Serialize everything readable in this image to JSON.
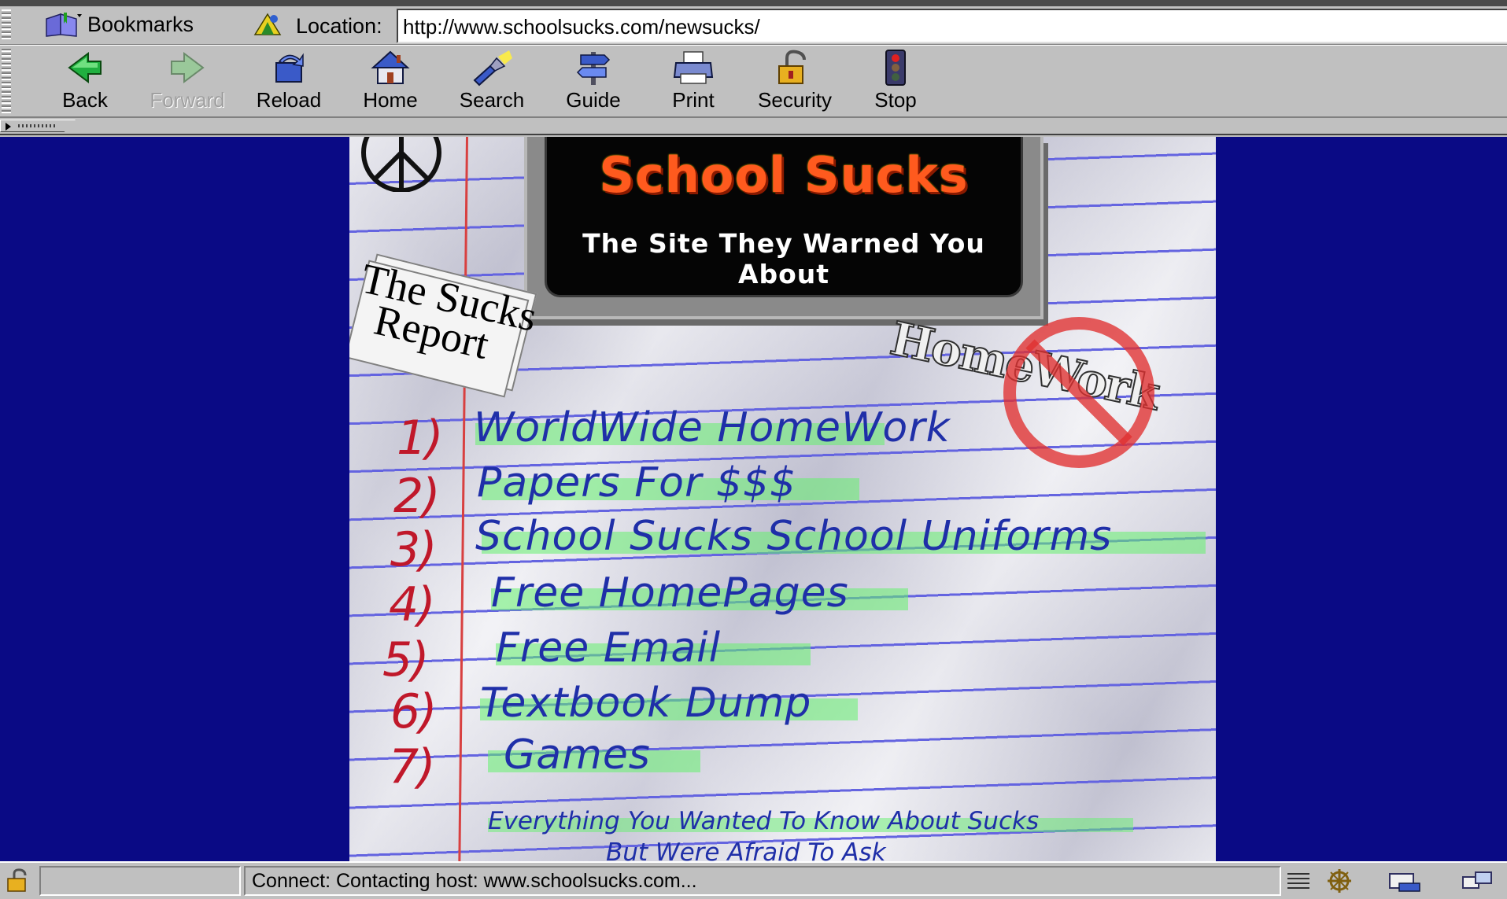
{
  "location_toolbar": {
    "bookmarks_label": "Bookmarks",
    "location_label": "Location:",
    "url": "http://www.schoolsucks.com/newsucks/"
  },
  "nav_toolbar": {
    "buttons": [
      {
        "label": "Back",
        "icon": "back-arrow-icon",
        "enabled": true
      },
      {
        "label": "Forward",
        "icon": "forward-arrow-icon",
        "enabled": false
      },
      {
        "label": "Reload",
        "icon": "reload-icon",
        "enabled": true
      },
      {
        "label": "Home",
        "icon": "house-icon",
        "enabled": true
      },
      {
        "label": "Search",
        "icon": "flashlight-icon",
        "enabled": true
      },
      {
        "label": "Guide",
        "icon": "signpost-icon",
        "enabled": true
      },
      {
        "label": "Print",
        "icon": "printer-icon",
        "enabled": true
      },
      {
        "label": "Security",
        "icon": "padlock-icon",
        "enabled": true
      },
      {
        "label": "Stop",
        "icon": "traffic-light-icon",
        "enabled": true
      }
    ]
  },
  "page": {
    "title": "School Sucks",
    "subtitle": "The Site They Warned You About",
    "sucks_report_line1": "The Sucks",
    "sucks_report_line2": "Report",
    "homework_word": "HomeWork",
    "menu": [
      {
        "num": "1)",
        "label": "WorldWide HomeWork"
      },
      {
        "num": "2)",
        "label": "Papers For $$$"
      },
      {
        "num": "3)",
        "label": "School Sucks School Uniforms"
      },
      {
        "num": "4)",
        "label": "Free HomePages"
      },
      {
        "num": "5)",
        "label": "Free Email"
      },
      {
        "num": "6)",
        "label": "Textbook Dump"
      },
      {
        "num": "7)",
        "label": "Games"
      }
    ],
    "tagline_line1": "Everything You Wanted To Know About Sucks",
    "tagline_line2": "But Were Afraid To Ask"
  },
  "status_bar": {
    "message": "Connect: Contacting host: www.schoolsucks.com..."
  },
  "colors": {
    "page_background": "#0a0a85",
    "title_orange": "#ff5a1e",
    "ink_blue": "#1f2fa8",
    "number_red": "#c0182a",
    "highlighter_green": "#64f06e"
  }
}
